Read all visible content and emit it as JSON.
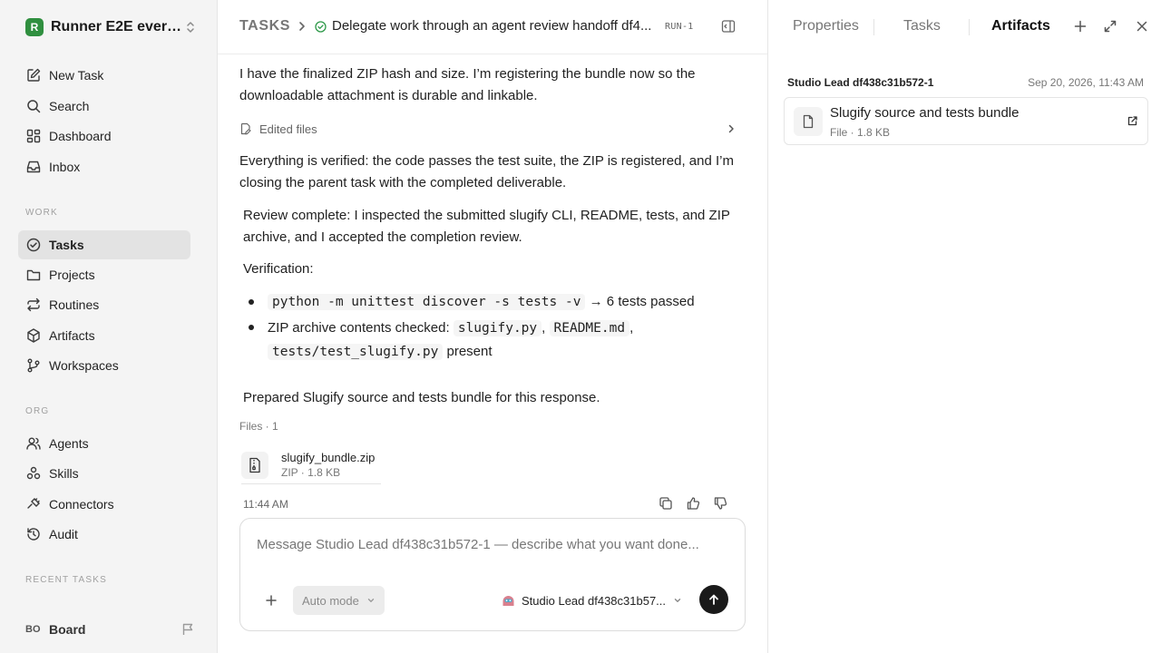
{
  "workspace": {
    "name": "Runner E2E ever…",
    "logo_letter": "R",
    "logo_color": "#2f8f3f"
  },
  "sidebar": {
    "main_items": [
      {
        "label": "New Task",
        "icon": "edit-icon"
      },
      {
        "label": "Search",
        "icon": "search-icon"
      },
      {
        "label": "Dashboard",
        "icon": "dashboard-icon"
      },
      {
        "label": "Inbox",
        "icon": "inbox-icon"
      }
    ],
    "work_label": "WORK",
    "work_items": [
      {
        "label": "Tasks",
        "icon": "check-circle-icon",
        "active": true
      },
      {
        "label": "Projects",
        "icon": "folder-icon"
      },
      {
        "label": "Routines",
        "icon": "repeat-icon"
      },
      {
        "label": "Artifacts",
        "icon": "cube-icon"
      },
      {
        "label": "Workspaces",
        "icon": "branch-icon"
      }
    ],
    "org_label": "ORG",
    "org_items": [
      {
        "label": "Agents",
        "icon": "users-icon"
      },
      {
        "label": "Skills",
        "icon": "skills-icon"
      },
      {
        "label": "Connectors",
        "icon": "plug-icon"
      },
      {
        "label": "Audit",
        "icon": "history-icon"
      }
    ],
    "recent_label": "RECENT TASKS",
    "board": {
      "avatar": "BO",
      "label": "Board"
    }
  },
  "header": {
    "breadcrumb_root": "TASKS",
    "task_title": "Delegate work through an agent review handoff df4...",
    "run_badge": "RUN-1"
  },
  "thread": {
    "msg1": "I have the finalized ZIP hash and size. I’m registering the bundle now so the downloadable attachment is durable and linkable.",
    "edited_files": "Edited files",
    "msg2": "Everything is verified: the code passes the test suite, the ZIP is registered, and I’m closing the parent task with the completed deliverable.",
    "review": "Review complete: I inspected the submitted slugify CLI, README, tests, and ZIP archive, and I accepted the completion review.",
    "verification_label": "Verification:",
    "bullet1_code": "python -m unittest discover -s tests -v",
    "bullet1_result": "→ 6 tests passed",
    "bullet2_prefix": "ZIP archive contents checked:",
    "bullet2_code_a": "slugify.py",
    "bullet2_code_b": "README.md",
    "bullet2_code_c": "tests/test_slugify.py",
    "bullet2_suffix": "present",
    "prepared": "Prepared Slugify source and tests bundle for this response.",
    "files_label": "Files · 1",
    "file": {
      "name": "slugify_bundle.zip",
      "meta": "ZIP · 1.8 KB"
    },
    "timestamp": "11:44 AM"
  },
  "composer": {
    "placeholder": "Message Studio Lead df438c31b572-1 — describe what you want done...",
    "mode": "Auto mode",
    "agent": "Studio Lead df438c31b57..."
  },
  "right_panel": {
    "tabs": [
      "Properties",
      "Tasks",
      "Artifacts"
    ],
    "active_tab": "Artifacts",
    "artifact_agent": "Studio Lead df438c31b572-1",
    "artifact_date": "Sep 20, 2026, 11:43 AM",
    "artifact_title": "Slugify source and tests bundle",
    "artifact_meta": "File · 1.8 KB"
  }
}
